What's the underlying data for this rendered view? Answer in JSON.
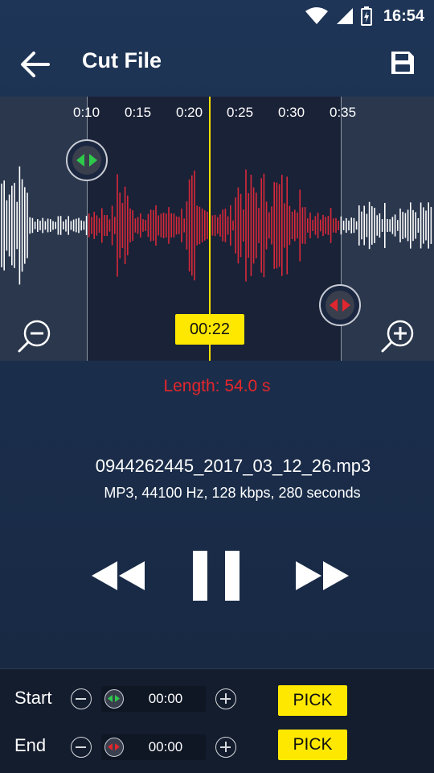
{
  "status_bar": {
    "time": "16:54"
  },
  "app_bar": {
    "title": "Cut File"
  },
  "waveform": {
    "ticks": [
      "0:10",
      "0:15",
      "0:20",
      "0:25",
      "0:30",
      "0:35"
    ],
    "current_time": "00:22",
    "colors": {
      "selected": "#d8293a",
      "unselected": "#ffffff",
      "playhead": "#ffe000"
    }
  },
  "length_label": "Length: 54.0 s",
  "file": {
    "name": "0944262445_2017_03_12_26.mp3",
    "info": "MP3, 44100 Hz, 128 kbps, 280 seconds"
  },
  "controls": {
    "start_label": "Start",
    "start_value": "00:00",
    "end_label": "End",
    "end_value": "00:00",
    "pick_label": "PICK"
  },
  "colors": {
    "accent": "#ffe800",
    "danger": "#e5262b",
    "start_handle": "#2ec84a",
    "end_handle": "#e0262e"
  }
}
